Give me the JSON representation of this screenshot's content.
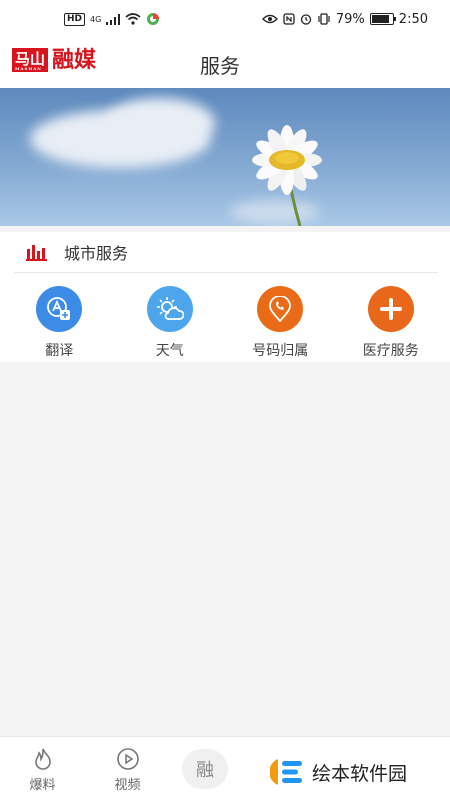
{
  "status_bar": {
    "hd": "HD",
    "signal": "4G",
    "battery": "79%",
    "battery_level": 0.79,
    "time": "2:50"
  },
  "header": {
    "logo_box": "马山",
    "logo_sub": "MASHAN",
    "logo_text": "融媒",
    "title": "服务"
  },
  "city_services": {
    "title": "城市服务",
    "items": [
      {
        "label": "翻译",
        "icon": "translate-icon",
        "color": "#3c8be6"
      },
      {
        "label": "天气",
        "icon": "weather-icon",
        "color": "#4da6ec"
      },
      {
        "label": "号码归属",
        "icon": "phone-location-icon",
        "color": "#ea6b17"
      },
      {
        "label": "医疗服务",
        "icon": "medical-plus-icon",
        "color": "#e8671a"
      }
    ]
  },
  "tabbar": {
    "items": [
      {
        "label": "爆料",
        "icon": "fire-icon"
      },
      {
        "label": "视频",
        "icon": "play-icon"
      }
    ],
    "center_label": "融"
  },
  "watermark": {
    "text": "绘本软件园"
  },
  "colors": {
    "brand_red": "#d7151e",
    "blue": "#3c8be6",
    "orange": "#e8671a"
  }
}
